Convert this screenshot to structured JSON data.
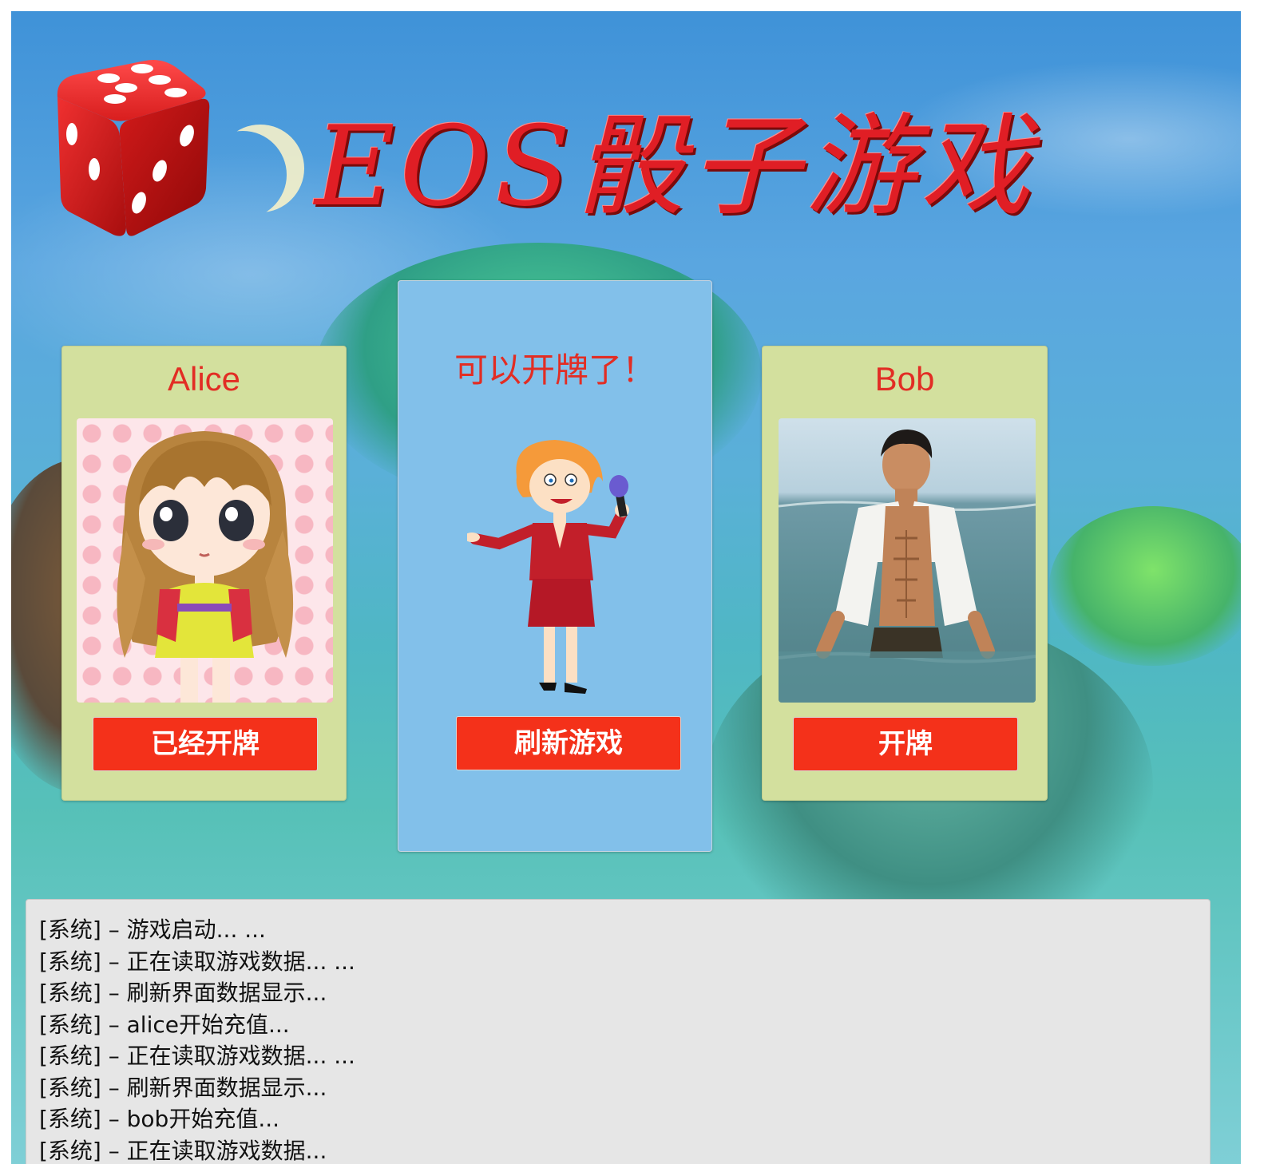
{
  "app": {
    "title": "EOS骰子游戏"
  },
  "players": {
    "alice": {
      "name": "Alice",
      "button_label": "已经开牌"
    },
    "bob": {
      "name": "Bob",
      "button_label": "开牌"
    }
  },
  "center": {
    "message": "可以开牌了！",
    "button_label": "刷新游戏"
  },
  "log": {
    "lines": [
      "[系统] – 游戏启动... ...",
      "[系统] – 正在读取游戏数据... ...",
      "[系统] – 刷新界面数据显示...",
      "[系统] – alice开始充值...",
      "[系统] – 正在读取游戏数据... ...",
      "[系统] – 刷新界面数据显示...",
      "[系统] – bob开始充值...",
      "[系统] – 正在读取游戏数据..."
    ]
  },
  "icons": {
    "logo": "dice-icon",
    "alice_avatar": "girl-cartoon-avatar",
    "bob_avatar": "man-photo-avatar",
    "host": "reporter-cartoon"
  },
  "colors": {
    "accent_red": "#f4311a",
    "player_card": "#d3e09e",
    "center_card": "#82c0ea",
    "log_bg": "#e6e6e6"
  }
}
